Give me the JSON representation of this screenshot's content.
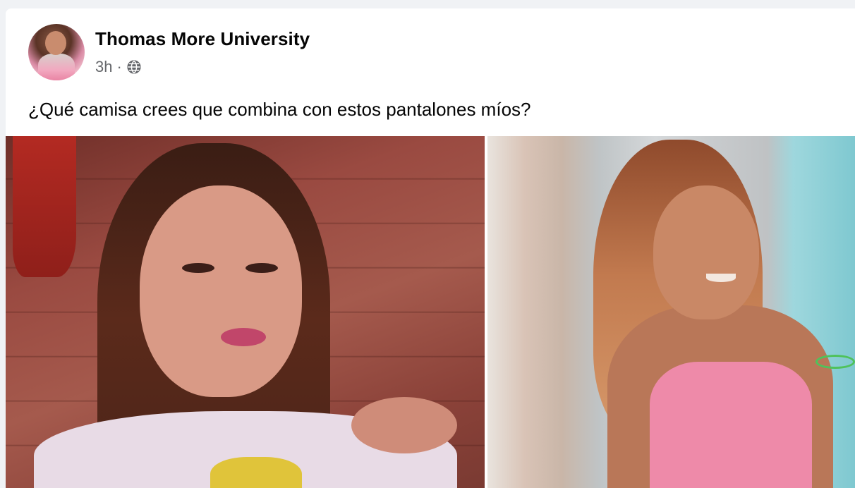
{
  "post": {
    "author": "Thomas More University",
    "time": "3h",
    "separator": "·",
    "audience_icon": "globe-icon",
    "text": "¿Qué camisa crees que combina con estos pantalones míos?"
  },
  "colors": {
    "page_background": "#f0f2f5",
    "card_background": "#ffffff",
    "name_text": "#050505",
    "meta_text": "#65676b"
  }
}
